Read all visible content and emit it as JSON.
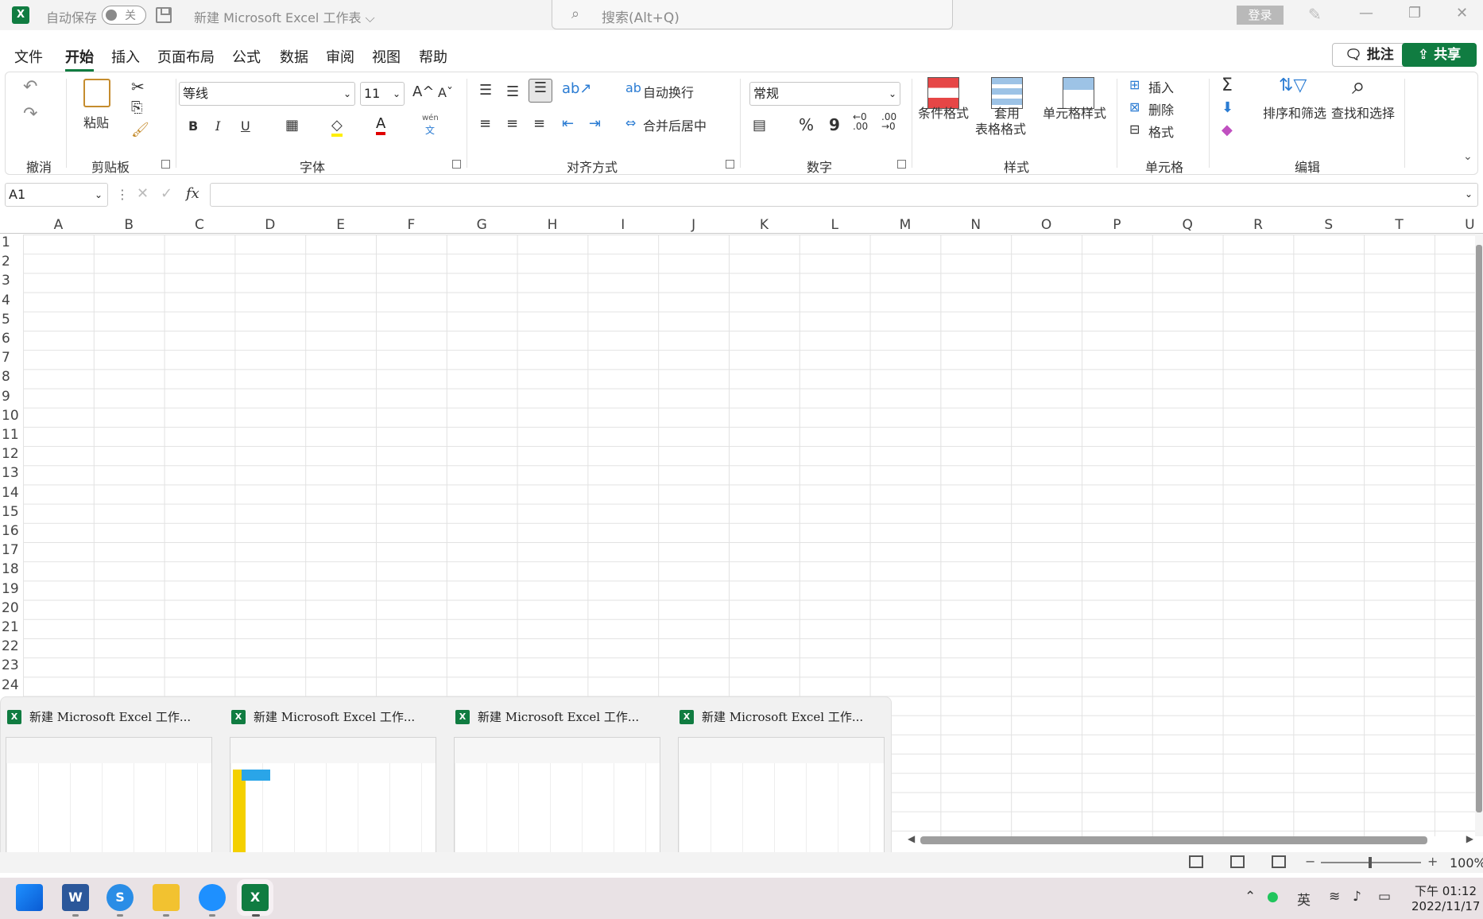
{
  "titlebar": {
    "autosave_label": "自动保存",
    "autosave_state": "关",
    "doc_title": "新建 Microsoft Excel 工作表 ⌵",
    "search_placeholder": "搜索(Alt+Q)",
    "login": "登录"
  },
  "menu": {
    "tabs": [
      "文件",
      "开始",
      "插入",
      "页面布局",
      "公式",
      "数据",
      "审阅",
      "视图",
      "帮助"
    ],
    "active": "开始",
    "comments": "批注",
    "share": "共享"
  },
  "ribbon": {
    "groups": {
      "undo": "撤消",
      "clipboard": "剪贴板",
      "font": "字体",
      "alignment": "对齐方式",
      "number": "数字",
      "styles": "样式",
      "cells": "单元格",
      "editing": "编辑"
    },
    "paste": "粘贴",
    "font_name": "等线",
    "font_size": "11",
    "bold": "B",
    "italic": "I",
    "underline": "U",
    "wen": "wén",
    "wen_char": "文",
    "wrap_text": "自动换行",
    "merge_center": "合并后居中",
    "number_format": "常规",
    "percent": "%",
    "comma": "9",
    "inc_decimal_a": "←0",
    "inc_decimal_b": ".00",
    "dec_decimal_a": ".00",
    "dec_decimal_b": "→0",
    "conditional_format": "条件格式",
    "format_as_table_1": "套用",
    "format_as_table_2": "表格格式",
    "cell_styles": "单元格样式",
    "insert": "插入",
    "delete": "删除",
    "format": "格式",
    "sort_filter": "排序和筛选",
    "find_select": "查找和选择"
  },
  "formula_bar": {
    "name_box": "A1",
    "fx": "fx",
    "value": ""
  },
  "grid": {
    "columns": [
      "A",
      "B",
      "C",
      "D",
      "E",
      "F",
      "G",
      "H",
      "I",
      "J",
      "K",
      "L",
      "M",
      "N",
      "O",
      "P",
      "Q",
      "R",
      "S",
      "T",
      "U"
    ],
    "rows": [
      "1",
      "2",
      "3",
      "4",
      "5",
      "6",
      "7",
      "8",
      "9",
      "10",
      "11",
      "12",
      "13",
      "14",
      "15",
      "16",
      "17",
      "18",
      "19",
      "20",
      "21",
      "22",
      "23",
      "24"
    ]
  },
  "thumbnails": [
    {
      "title": "新建 Microsoft Excel 工作..."
    },
    {
      "title": "新建 Microsoft Excel 工作..."
    },
    {
      "title": "新建 Microsoft Excel 工作..."
    },
    {
      "title": "新建 Microsoft Excel 工作..."
    }
  ],
  "status": {
    "zoom": "100%"
  },
  "taskbar": {
    "time": "下午 01:12",
    "date": "2022/11/17",
    "ime": "英"
  },
  "colors": {
    "accent": "#107c41"
  }
}
